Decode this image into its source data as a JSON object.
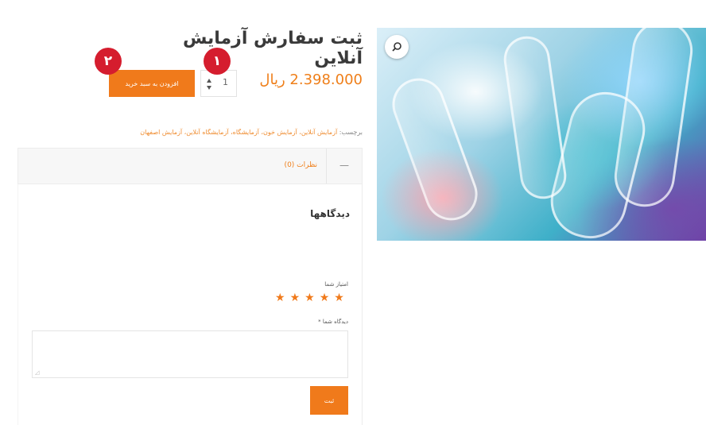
{
  "product": {
    "title": "ثبت سفارش آزمایش آنلاین",
    "price": "2.398.000 ریال",
    "quantity": "1",
    "add_to_cart_label": "افزودن به سبد خرید",
    "image_icon": "test-tubes-photo"
  },
  "annotations": {
    "badge_1": "١",
    "badge_2": "٢"
  },
  "tags": {
    "prefix": "برچسب:",
    "links": "آزمایش آنلاین، آزمایش خون، آزمایشگاه، آزمایشگاه آنلاین، آزمایش اصفهان"
  },
  "tabs": {
    "reviews_tab_label": "نظرات (0)",
    "toggle_symbol": "—"
  },
  "reviews": {
    "title": "دیدگاهها",
    "rating_label": "امتیاز شما",
    "comment_label": "دیدگاه شما *",
    "submit_label": "ثبت",
    "stars": [
      "★",
      "★",
      "★",
      "★",
      "★"
    ]
  },
  "colors": {
    "accent": "#f07a1b",
    "badge": "#d51d2e"
  }
}
